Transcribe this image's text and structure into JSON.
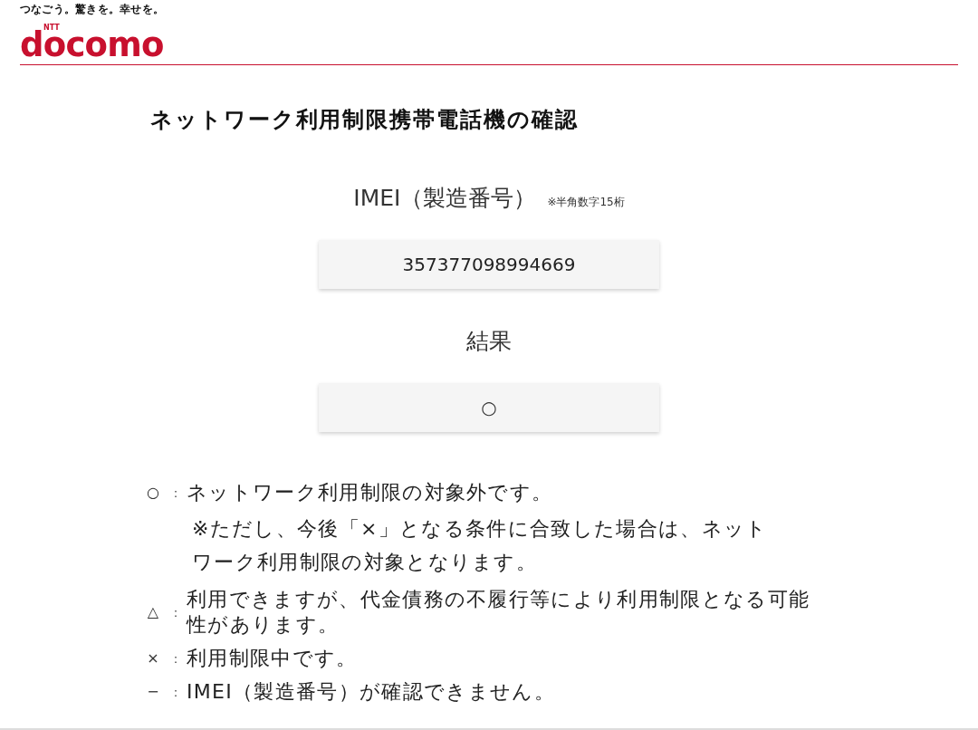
{
  "header": {
    "tagline": "つなごう。驚きを。幸せを。",
    "logo": {
      "mark": "NTT",
      "name": "docomo"
    }
  },
  "page_title": "ネットワーク利用制限携帯電話機の確認",
  "imei": {
    "label": "IMEI（製造番号）",
    "hint": "※半角数字15桁",
    "value": "357377098994669"
  },
  "result": {
    "label": "結果",
    "value": "○"
  },
  "legend": [
    {
      "symbol": "○",
      "separator": "：",
      "text": "ネットワーク利用制限の対象外です。",
      "note": "※ただし、今後「×」となる条件に合致した場合は、ネットワーク利用制限の対象となります。"
    },
    {
      "symbol": "△",
      "separator": "：",
      "text": "利用できますが、代金債務の不履行等により利用制限となる可能性があります。"
    },
    {
      "symbol": "×",
      "separator": "：",
      "text": "利用制限中です。"
    },
    {
      "symbol": "−",
      "separator": "：",
      "text": "IMEI（製造番号）が確認できません。"
    }
  ]
}
